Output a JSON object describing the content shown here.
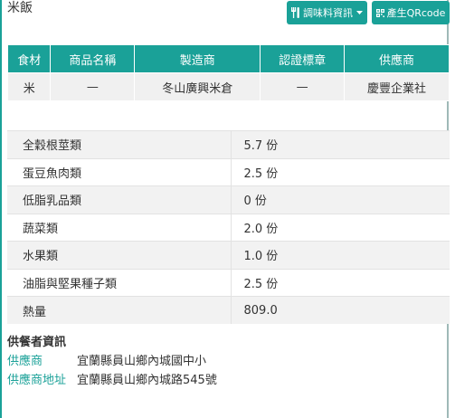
{
  "page": {
    "title": "米飯"
  },
  "toolbar": {
    "seasoning_label": "調味料資訊",
    "qrcode_label": "產生QRcode",
    "seasoning_icon": "fork-knife-icon",
    "qrcode_icon": "qrcode-icon"
  },
  "ingredient_table": {
    "headers": [
      "食材",
      "商品名稱",
      "製造商",
      "認證標章",
      "供應商"
    ],
    "rows": [
      [
        "米",
        "—",
        "冬山廣興米倉",
        "—",
        "慶豐企業社"
      ]
    ]
  },
  "nutrition": {
    "rows": [
      {
        "name": "全穀根莖類",
        "value": "5.7 份"
      },
      {
        "name": "蛋豆魚肉類",
        "value": "2.5 份"
      },
      {
        "name": "低脂乳品類",
        "value": "0 份"
      },
      {
        "name": "蔬菜類",
        "value": "2.0 份"
      },
      {
        "name": "水果類",
        "value": "1.0 份"
      },
      {
        "name": "油脂與堅果種子類",
        "value": "2.5 份"
      },
      {
        "name": "熱量",
        "value": "809.0"
      }
    ]
  },
  "supplier": {
    "heading": "供餐者資訊",
    "provider_label": "供應商",
    "provider_value": "宜蘭縣員山鄉內城國中小",
    "address_label": "供應商地址",
    "address_value": "宜蘭縣員山鄉內城路545號"
  },
  "colors": {
    "accent": "#1aa198",
    "row_alt": "#f2f2f2"
  }
}
